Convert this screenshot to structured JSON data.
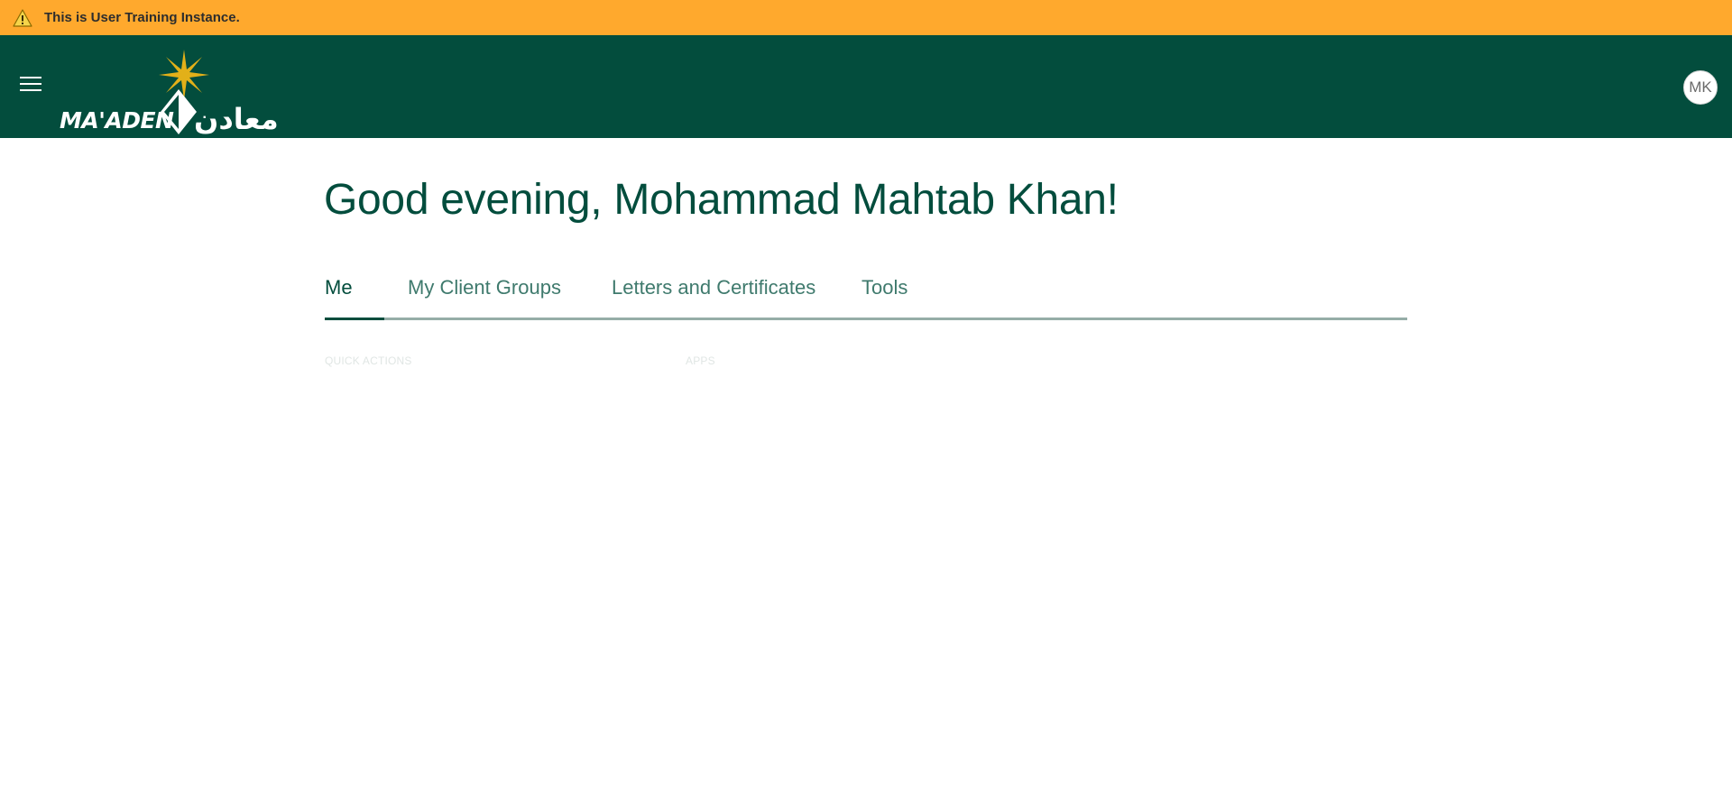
{
  "banner": {
    "icon": "warning-icon",
    "text": "This is User Training Instance.",
    "color": "#ffa92d"
  },
  "header": {
    "background": "#034d3d",
    "menu_icon": "hamburger-menu-icon",
    "logo": {
      "latin": "MA'ADEN",
      "arabic": "معادن"
    },
    "avatar_initials": "MK"
  },
  "main": {
    "greeting": "Good evening, Mohammad Mahtab Khan!",
    "tabs": [
      {
        "label": "Me",
        "active": true
      },
      {
        "label": "My Client Groups",
        "active": false
      },
      {
        "label": "Letters and Certificates",
        "active": false
      },
      {
        "label": "Tools",
        "active": false
      }
    ],
    "sections": {
      "quick_actions": "QUICK ACTIONS",
      "apps": "APPS"
    }
  }
}
